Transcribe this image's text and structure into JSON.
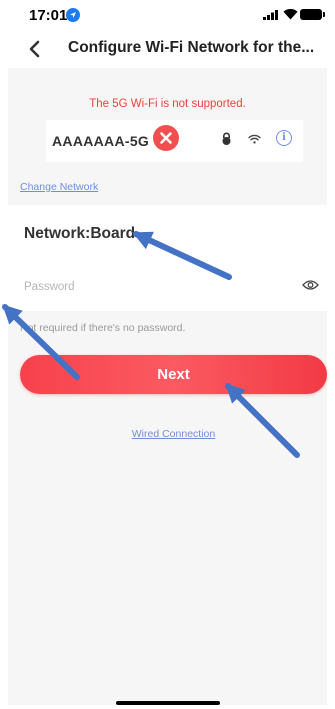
{
  "status_bar": {
    "time": "17:01"
  },
  "nav": {
    "title": "Configure Wi-Fi Network for the..."
  },
  "error_message": "The 5G Wi-Fi is not supported.",
  "network_card": {
    "ssid": "AAAAAAA-5G",
    "info_glyph": "i"
  },
  "change_network_link": "Change Network",
  "network_label": "Network:Board",
  "password": {
    "placeholder": "Password",
    "value": ""
  },
  "hint": "Not required if there's no password.",
  "next_button": "Next",
  "wired_link": "Wired Connection",
  "colors": {
    "accent_red": "#f14f4f",
    "link_blue": "#6f8ede",
    "annotation_arrow": "#4472c4"
  }
}
